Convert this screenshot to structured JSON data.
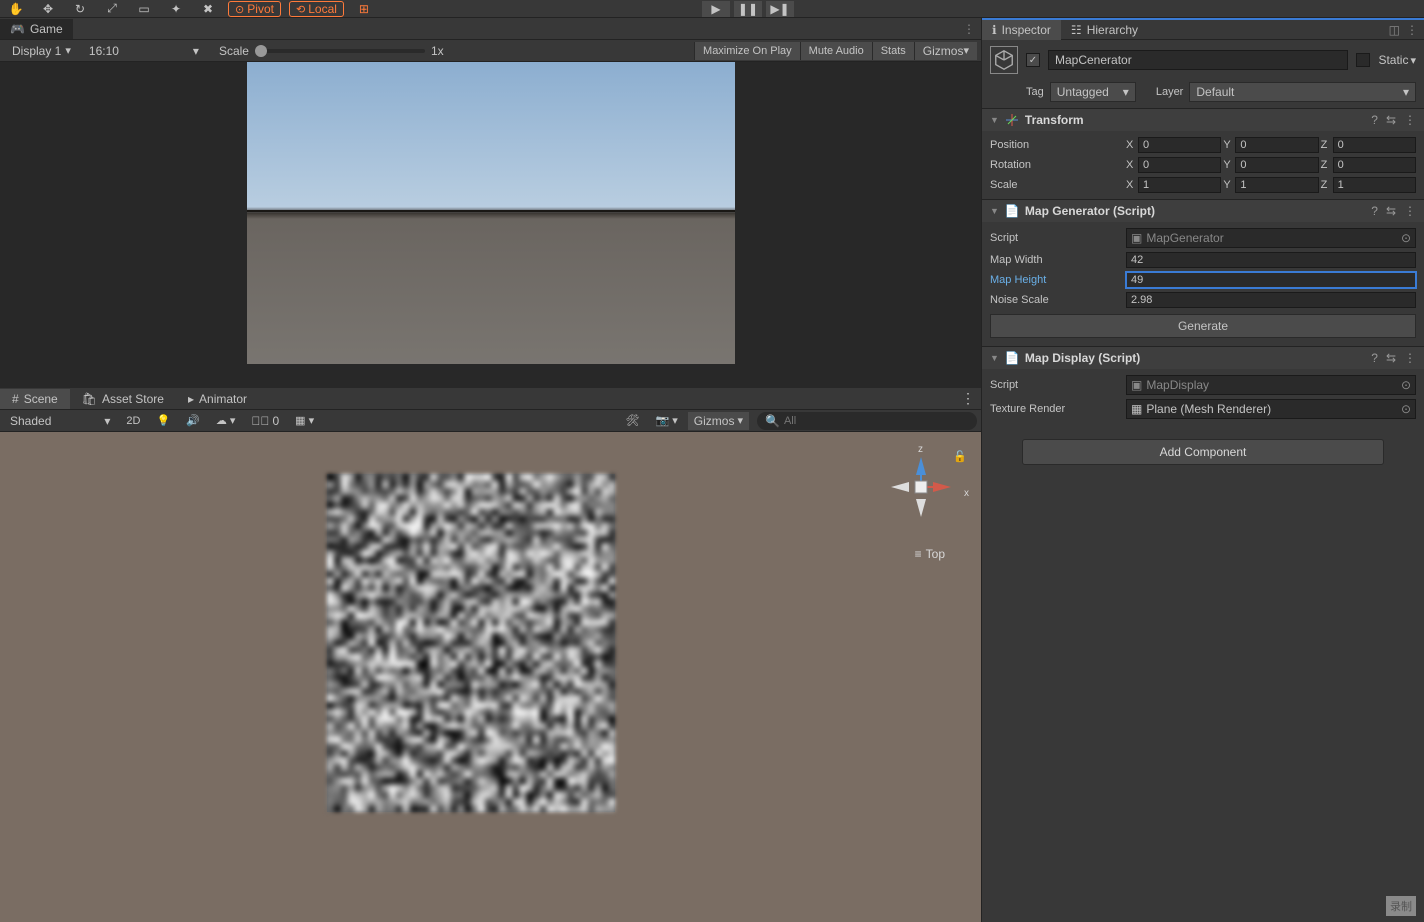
{
  "topbar": {
    "pivot": "Pivot",
    "local": "Local"
  },
  "game": {
    "tab": "Game",
    "display": "Display 1",
    "aspect": "16:10",
    "scale_label": "Scale",
    "scale_value": "1x",
    "buttons": {
      "maximize": "Maximize On Play",
      "mute": "Mute Audio",
      "stats": "Stats",
      "gizmos": "Gizmos"
    }
  },
  "scene": {
    "tabs": {
      "scene": "Scene",
      "asset_store": "Asset Store",
      "animator": "Animator"
    },
    "shading": "Shaded",
    "mode2d": "2D",
    "layers_off": "0",
    "gizmos": "Gizmos",
    "search_placeholder": "All",
    "axis_z": "z",
    "axis_x": "x",
    "view_label": "Top"
  },
  "inspector": {
    "tabs": {
      "inspector": "Inspector",
      "hierarchy": "Hierarchy"
    },
    "object_name": "MapCenerator",
    "static": "Static",
    "tag_label": "Tag",
    "tag_value": "Untagged",
    "layer_label": "Layer",
    "layer_value": "Default",
    "transform": {
      "title": "Transform",
      "position": {
        "label": "Position",
        "x": "0",
        "y": "0",
        "z": "0"
      },
      "rotation": {
        "label": "Rotation",
        "x": "0",
        "y": "0",
        "z": "0"
      },
      "scale": {
        "label": "Scale",
        "x": "1",
        "y": "1",
        "z": "1"
      }
    },
    "mapgen": {
      "title": "Map Generator (Script)",
      "script_label": "Script",
      "script_value": "MapGenerator",
      "width_label": "Map Width",
      "width_value": "42",
      "height_label": "Map Height",
      "height_value": "49",
      "noise_label": "Noise Scale",
      "noise_value": "2.98",
      "generate": "Generate"
    },
    "mapdisplay": {
      "title": "Map Display (Script)",
      "script_label": "Script",
      "script_value": "MapDisplay",
      "texture_label": "Texture Render",
      "texture_value": "Plane (Mesh Renderer)"
    },
    "add_component": "Add Component"
  },
  "recording": "录制"
}
